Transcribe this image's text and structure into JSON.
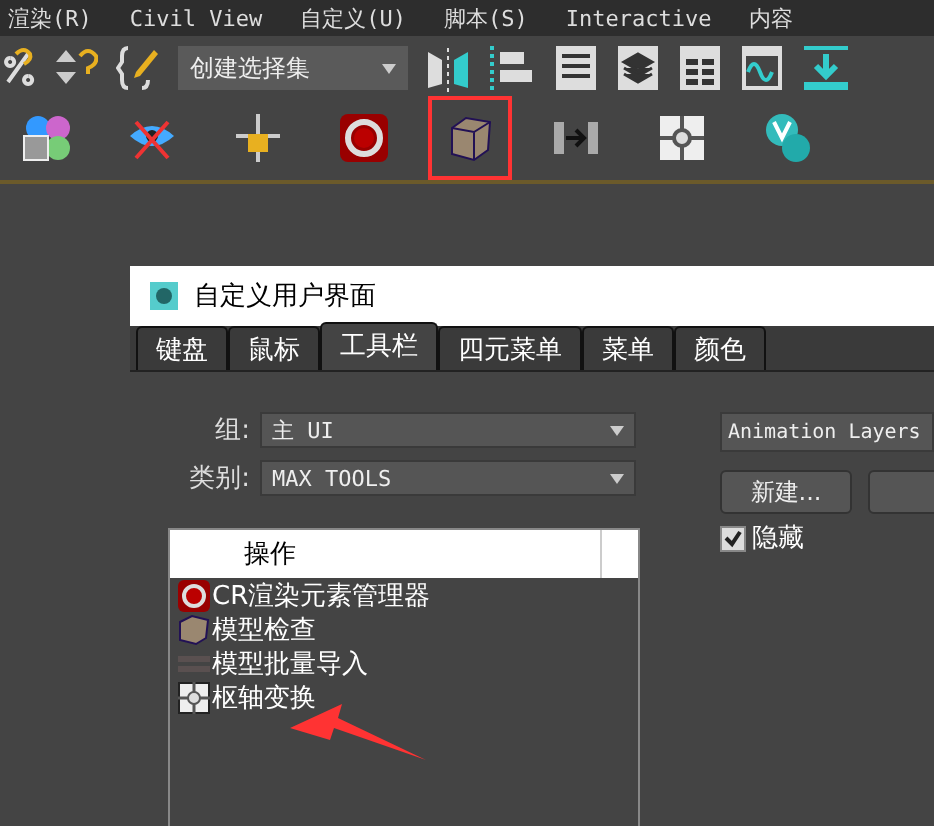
{
  "menu_bar": {
    "items": [
      "渲染(R)",
      "Civil View",
      "自定义(U)",
      "脚本(S)",
      "Interactive",
      "内容"
    ]
  },
  "toolbar": {
    "selection_set": {
      "value": "创建选择集"
    }
  },
  "toolbar_2": {
    "tools": [
      {
        "highlighted": false
      },
      {
        "highlighted": false
      },
      {
        "highlighted": false
      },
      {
        "highlighted": false
      },
      {
        "highlighted": true
      },
      {
        "highlighted": false
      },
      {
        "highlighted": false
      },
      {
        "highlighted": false
      }
    ]
  },
  "dialog": {
    "title": "自定义用户界面",
    "tabs": [
      {
        "label": "键盘",
        "selected": false
      },
      {
        "label": "鼠标",
        "selected": false
      },
      {
        "label": "工具栏",
        "selected": true
      },
      {
        "label": "四元菜单",
        "selected": false
      },
      {
        "label": "菜单",
        "selected": false
      },
      {
        "label": "颜色",
        "selected": false
      }
    ],
    "group": {
      "label": "组:",
      "value": "主 UI"
    },
    "category": {
      "label": "类别:",
      "value": "MAX TOOLS"
    },
    "actions": {
      "header": "操作",
      "items": [
        {
          "label": "CR渲染元素管理器"
        },
        {
          "label": "模型检查"
        },
        {
          "label": "模型批量导入"
        },
        {
          "label": "枢轴变换"
        }
      ]
    },
    "toolbar_select": {
      "value": "Animation Layers"
    },
    "buttons": [
      {
        "kind": "labeled",
        "label": "新建..."
      },
      {
        "kind": "cut"
      }
    ],
    "hide": {
      "label": "隐藏",
      "checked": true
    },
    "annotation": {
      "kind": "arrow"
    }
  }
}
